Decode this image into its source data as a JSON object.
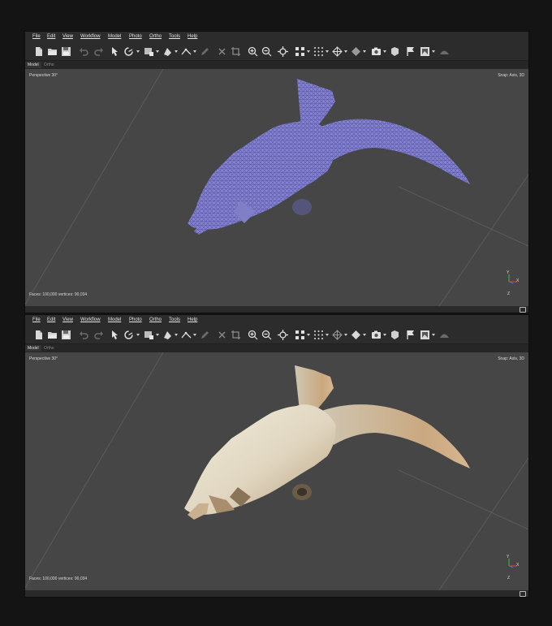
{
  "menu": [
    "File",
    "Edit",
    "View",
    "Workflow",
    "Model",
    "Photo",
    "Ortho",
    "Tools",
    "Help"
  ],
  "tabs": [
    "Model",
    "Ortho"
  ],
  "windows": [
    {
      "view_label": "Perspective 30°",
      "snap_label": "Snap: Axis, 3D",
      "stats": "Faces: 100,000 vertices: 90,034",
      "axes": {
        "x": "X",
        "y": "Y",
        "z": "Z"
      },
      "mode": "wireframe"
    },
    {
      "view_label": "Perspective 30°",
      "snap_label": "Snap: Axis, 3D",
      "stats": "Faces: 100,000 vertices: 90,034",
      "axes": {
        "x": "X",
        "y": "Y",
        "z": "Z"
      },
      "mode": "textured"
    }
  ],
  "toolbar_icons": [
    "new-document-icon",
    "open-folder-icon",
    "save-icon",
    "undo-icon",
    "redo-icon",
    "navigation-arrow-icon",
    "rotate-object-icon",
    "selection-rect-icon",
    "shape-draw-icon",
    "ruler-measure-icon",
    "pencil-icon",
    "delete-icon",
    "crop-icon",
    "zoom-in-icon",
    "zoom-out-icon",
    "reset-view-icon",
    "point-cloud-icon",
    "dense-cloud-icon",
    "mesh-icon",
    "shaded-model-icon",
    "camera-icon",
    "tiled-model-icon",
    "flag-marker-icon",
    "show-images-icon",
    "dem-icon"
  ],
  "colors": {
    "window_bg": "#2c2c2c",
    "viewport_bg": "#464646",
    "wireframe_mesh": "#8a89d6",
    "bone_texture": "#e8e1d0"
  }
}
